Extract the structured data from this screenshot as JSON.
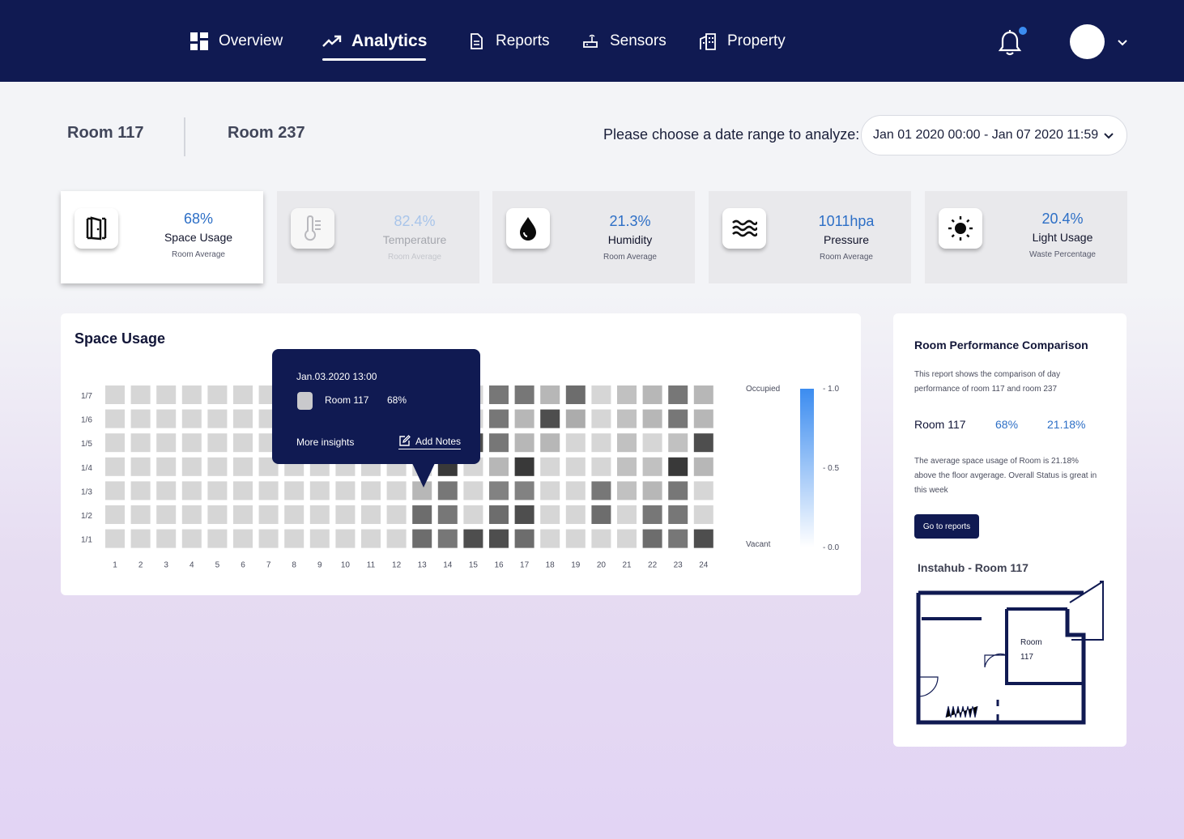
{
  "nav": {
    "items": [
      {
        "label": "Overview",
        "icon": "dashboard-icon"
      },
      {
        "label": "Analytics",
        "icon": "trend-up-icon",
        "active": true
      },
      {
        "label": "Reports",
        "icon": "document-icon"
      },
      {
        "label": "Sensors",
        "icon": "router-icon"
      },
      {
        "label": "Property",
        "icon": "building-icon"
      }
    ],
    "notification_dot_color": "#3b8cf0"
  },
  "rooms": {
    "tab1": "Room 117",
    "tab2": "Room 237"
  },
  "date_range": {
    "label": "Please choose a date range to analyze:",
    "value": "Jan 01 2020 00:00 - Jan 07 2020 11:59"
  },
  "metrics": [
    {
      "value": "68%",
      "title": "Space Usage",
      "subtitle": "Room Average",
      "icon": "door-icon",
      "state": "active"
    },
    {
      "value": "82.4%",
      "title": "Temperature",
      "subtitle": "Room Average",
      "icon": "thermometer-icon",
      "state": "disabled"
    },
    {
      "value": "21.3%",
      "title": "Humidity",
      "subtitle": "Room Average",
      "icon": "water-drop-icon",
      "state": "normal"
    },
    {
      "value": "1011hpa",
      "title": "Pressure",
      "subtitle": "Room Average",
      "icon": "waves-icon",
      "state": "normal"
    },
    {
      "value": "20.4%",
      "title": "Light Usage",
      "subtitle": "Waste Percentage",
      "icon": "sun-icon",
      "state": "normal"
    }
  ],
  "space_usage": {
    "title": "Space Usage",
    "tooltip": {
      "date": "Jan.03.2020 13:00",
      "room": "Room 117",
      "value": "68%",
      "more": "More insights",
      "notes": "Add Notes"
    }
  },
  "chart_data": {
    "type": "heatmap",
    "title": "Space Usage",
    "x": [
      "1",
      "2",
      "3",
      "4",
      "5",
      "6",
      "7",
      "8",
      "9",
      "10",
      "11",
      "12",
      "13",
      "14",
      "15",
      "16",
      "17",
      "18",
      "19",
      "20",
      "21",
      "22",
      "23",
      "24"
    ],
    "y": [
      "1/7",
      "1/6",
      "1/5",
      "1/4",
      "1/3",
      "1/2",
      "1/1"
    ],
    "values": [
      [
        0.1,
        0.1,
        0.1,
        0.1,
        0.1,
        0.1,
        0.1,
        0.1,
        0.1,
        0.1,
        0.1,
        0.1,
        0.1,
        0.1,
        0.1,
        0.55,
        0.55,
        0.25,
        0.6,
        0.1,
        0.2,
        0.25,
        0.55,
        0.25
      ],
      [
        0.1,
        0.1,
        0.1,
        0.1,
        0.1,
        0.1,
        0.1,
        0.1,
        0.1,
        0.1,
        0.1,
        0.1,
        0.1,
        0.1,
        0.1,
        0.55,
        0.25,
        0.75,
        0.3,
        0.1,
        0.2,
        0.25,
        0.55,
        0.25
      ],
      [
        0.1,
        0.1,
        0.1,
        0.1,
        0.1,
        0.1,
        0.1,
        0.1,
        0.1,
        0.1,
        0.1,
        0.1,
        0.1,
        0.1,
        0.75,
        0.55,
        0.25,
        0.25,
        0.1,
        0.1,
        0.2,
        0.1,
        0.2,
        0.75
      ],
      [
        0.1,
        0.1,
        0.1,
        0.1,
        0.1,
        0.1,
        0.1,
        0.1,
        0.1,
        0.1,
        0.1,
        0.1,
        0.1,
        0.85,
        0.1,
        0.25,
        0.85,
        0.1,
        0.1,
        0.1,
        0.2,
        0.2,
        0.85,
        0.25
      ],
      [
        0.1,
        0.1,
        0.1,
        0.1,
        0.1,
        0.1,
        0.1,
        0.1,
        0.1,
        0.1,
        0.1,
        0.1,
        0.25,
        0.55,
        0.1,
        0.5,
        0.5,
        0.1,
        0.1,
        0.55,
        0.2,
        0.25,
        0.55,
        0.1
      ],
      [
        0.1,
        0.1,
        0.1,
        0.1,
        0.1,
        0.1,
        0.1,
        0.1,
        0.1,
        0.1,
        0.1,
        0.1,
        0.6,
        0.55,
        0.1,
        0.6,
        0.75,
        0.1,
        0.1,
        0.6,
        0.1,
        0.55,
        0.55,
        0.1
      ],
      [
        0.1,
        0.1,
        0.1,
        0.1,
        0.1,
        0.1,
        0.1,
        0.1,
        0.1,
        0.1,
        0.1,
        0.1,
        0.6,
        0.55,
        0.75,
        0.75,
        0.6,
        0.1,
        0.1,
        0.1,
        0.1,
        0.6,
        0.55,
        0.75
      ]
    ],
    "legend": {
      "top": "Occupied",
      "bottom": "Vacant",
      "ticks": [
        "1.0",
        "0.5",
        "0.0"
      ],
      "accent_color": "#3b8cf0"
    },
    "vmin": 0.0,
    "vmax": 1.0
  },
  "comparison": {
    "title": "Room Performance Comparison",
    "description": "This report shows the comparison of day performance of room 117 and room 237",
    "room": "Room 117",
    "value1": "68%",
    "value2": "21.18%",
    "note": "The average space usage of Room is 21.18% above the floor avgerage. Overall Status is great in this week",
    "button": "Go to reports",
    "floorplan_title": "Instahub - Room 117",
    "floorplan_room_label": "Room",
    "floorplan_room_number": "117"
  },
  "colors": {
    "navy": "#101a52",
    "accent_blue": "#2d6fc6"
  }
}
